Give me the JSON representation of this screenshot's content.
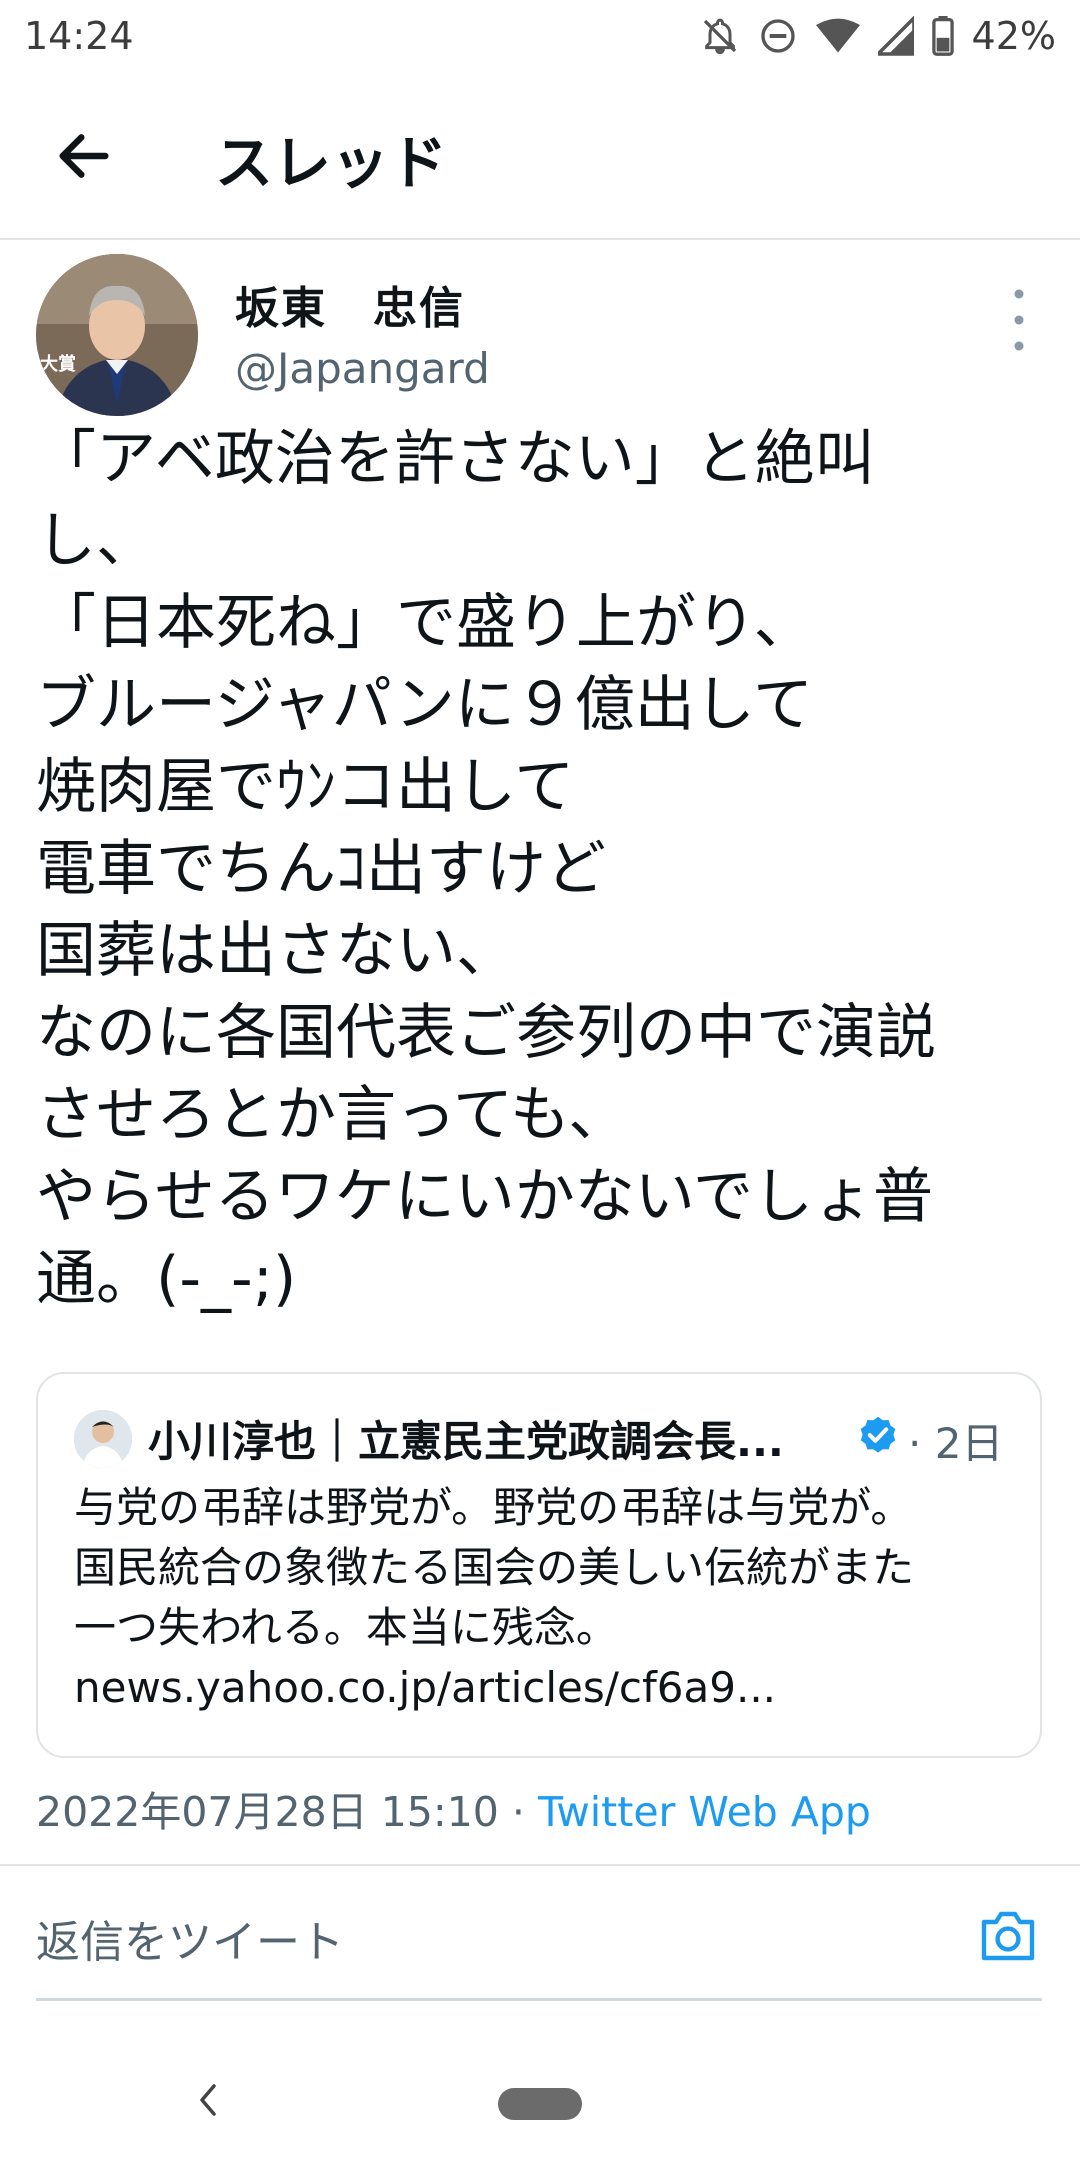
{
  "status_bar": {
    "time": "14:24",
    "battery": "42%"
  },
  "header": {
    "title": "スレッド"
  },
  "tweet": {
    "author_name": "坂東　忠信",
    "author_handle": "@Japangard",
    "avatar_caption": "大賞",
    "text": "「アベ政治を許さない」と絶叫\nし、\n「日本死ね」で盛り上がり、\nブルージャパンに９億出して\n焼肉屋でｳﾝコ出して\n電車でちんｺ出すけど\n国葬は出さない、\nなのに各国代表ご参列の中で演説\nさせろとか言っても、\nやらせるワケにいかないでしょ普\n通。(-_-;)",
    "timestamp": "2022年07月28日 15:10 · ",
    "source_app": "Twitter Web App"
  },
  "quote": {
    "author": "小川淳也｜立憲民主党政調会長...",
    "time": "· 2日",
    "text": "与党の弔辞は野党が。野党の弔辞は与党が。\n国民統合の象徴たる国会の美しい伝統がまた\n一つ失われる。本当に残念。\nnews.yahoo.co.jp/articles/cf6a9..."
  },
  "reply": {
    "placeholder": "返信をツイート"
  },
  "icons": {
    "back": "arrow-left-icon",
    "more": "more-vertical-icon",
    "verified": "verified-badge-icon",
    "camera": "camera-icon",
    "status": [
      "bell-off-icon",
      "dnd-icon",
      "wifi-icon",
      "signal-icon",
      "battery-icon"
    ]
  },
  "colors": {
    "link": "#1d9bf0",
    "secondary_text": "#536471",
    "divider": "#e1e4e7"
  }
}
